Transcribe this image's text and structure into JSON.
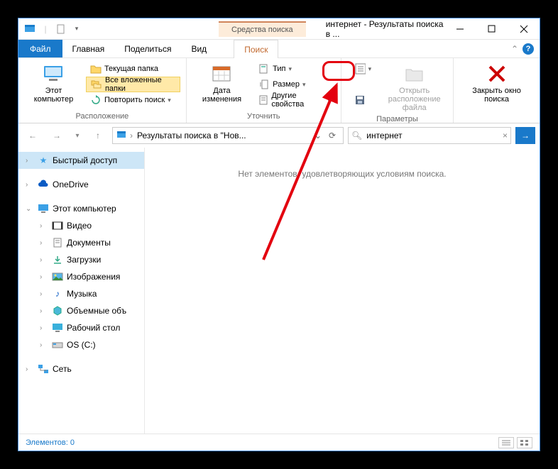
{
  "title": "интернет - Результаты поиска в ...",
  "context_tab": "Средства поиска",
  "menu": {
    "file": "Файл",
    "home": "Главная",
    "share": "Поделиться",
    "view": "Вид",
    "search": "Поиск"
  },
  "ribbon": {
    "group_location": "Расположение",
    "group_refine": "Уточнить",
    "group_options": "Параметры",
    "this_pc_btn": "Этот компьютер",
    "current_folder": "Текущая папка",
    "all_subfolders": "Все вложенные папки",
    "search_again": "Повторить поиск",
    "date_modified": "Дата изменения",
    "type": "Тип",
    "size": "Размер",
    "other_props": "Другие свойства",
    "open_location": "Открыть расположение файла",
    "close_search": "Закрыть окно поиска"
  },
  "addressbar": {
    "path": "Результаты поиска в \"Нов...",
    "search_value": "интернет"
  },
  "tree": {
    "quick_access": "Быстрый доступ",
    "onedrive": "OneDrive",
    "this_pc": "Этот компьютер",
    "videos": "Видео",
    "documents": "Документы",
    "downloads": "Загрузки",
    "pictures": "Изображения",
    "music": "Музыка",
    "volumes": "Объемные объ",
    "desktop": "Рабочий стол",
    "os_c": "OS (C:)",
    "network": "Сеть"
  },
  "content": {
    "empty": "Нет элементов, удовлетворяющих условиям поиска."
  },
  "status": {
    "items": "Элементов: 0"
  }
}
